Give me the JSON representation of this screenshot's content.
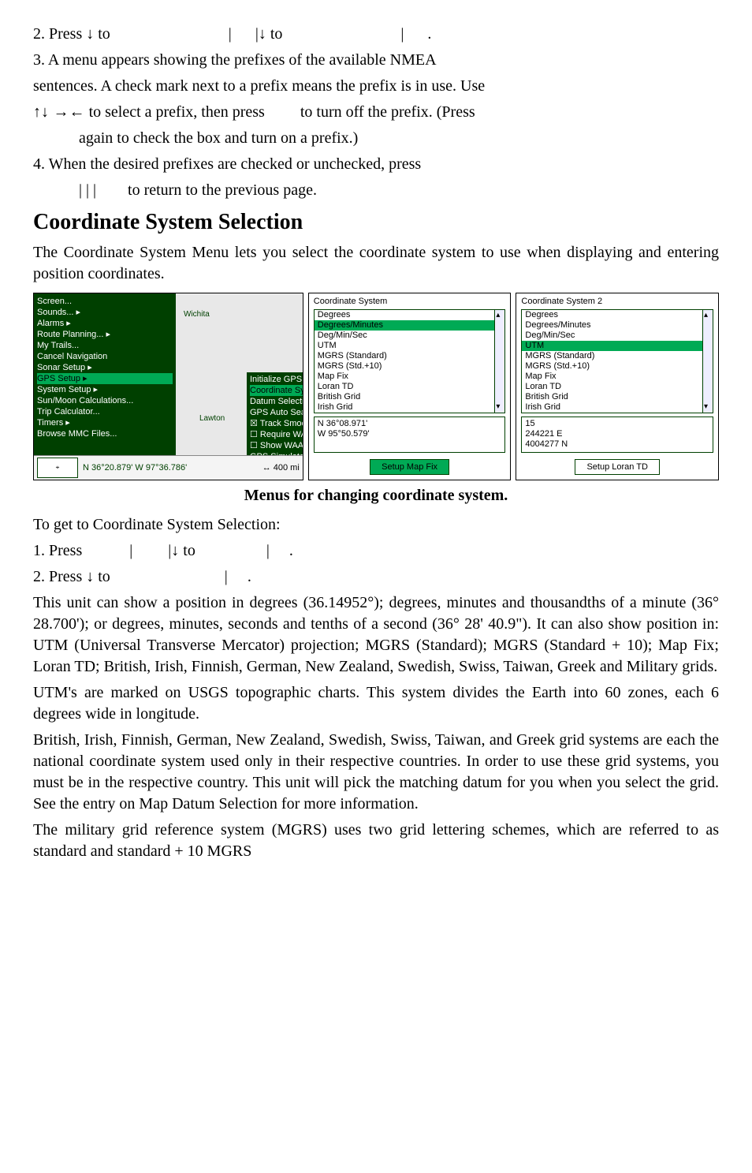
{
  "step2": {
    "prefix": "2. Press ",
    "down": "↓",
    "to1": " to",
    "pipe1": "|",
    "pipe2": "|",
    "down2": "↓",
    "to2": " to",
    "pipe3": "|",
    "dot": "."
  },
  "step3": {
    "line1": "3. A menu appears showing the prefixes of the available NMEA",
    "line2": "sentences. A check mark next to a prefix means the prefix is in use. Use",
    "arrows": "↑↓ →←",
    "mid": " to select a prefix, then press",
    "end": "to turn off the prefix. (Press",
    "cont": "again to check the box and turn on a prefix.)"
  },
  "step4": {
    "line1": "4. When the desired prefixes are checked or unchecked, press",
    "pipes": "|     |     |",
    "ret": "to return to the previous page."
  },
  "heading": "Coordinate System Selection",
  "intro": "The Coordinate System Menu lets you select the coordinate system to use when displaying and entering position coordinates.",
  "caption": "Menus for changing coordinate system.",
  "fig": {
    "leftMenu": [
      "Screen...",
      "Sounds...",
      "Alarms",
      "Route Planning...",
      "My Trails...",
      "Cancel Navigation",
      "Sonar Setup",
      "GPS Setup",
      "System Setup",
      "Sun/Moon Calculations...",
      "Trip Calculator...",
      "Timers",
      "Browse MMC Files..."
    ],
    "leftMenuSelectedIndex": 7,
    "leftMenuArrowIndexes": [
      1,
      2,
      3,
      6,
      7,
      8,
      11
    ],
    "subMenu": [
      "Initialize GPS",
      "Coordinate System...",
      "Datum Selection...",
      "GPS Auto Search",
      "☒ Track Smoothing",
      "☐ Require WAAS",
      "☐ Show WAAS Alarm",
      "GPS Simulator..."
    ],
    "subMenuSelectedIndex": 1,
    "mapCities": {
      "wichita": "Wichita",
      "lawton": "Lawton"
    },
    "coordStrip": "N   36°20.879'    W    97°36.786'",
    "zoom": "↔   400 mi",
    "miniIcon": "⌖",
    "panelMid": {
      "title": "Coordinate System",
      "options": [
        "Degrees",
        "Degrees/Minutes",
        "Deg/Min/Sec",
        "UTM",
        "MGRS (Standard)",
        "MGRS (Std.+10)",
        "Map Fix",
        "Loran TD",
        "British Grid",
        "Irish Grid"
      ],
      "selectedIndex": 1,
      "coords": [
        "N   36°08.971'",
        "W  95°50.579'"
      ],
      "button": "Setup Map Fix"
    },
    "panelRight": {
      "title": "Coordinate System 2",
      "options": [
        "Degrees",
        "Degrees/Minutes",
        "Deg/Min/Sec",
        "UTM",
        "MGRS (Standard)",
        "MGRS (Std.+10)",
        "Map Fix",
        "Loran TD",
        "British Grid",
        "Irish Grid"
      ],
      "selectedIndex": 3,
      "coords": [
        "15",
        " 244221 E",
        "4004277 N"
      ],
      "button": "Setup Loran TD"
    }
  },
  "postFigIntro": "To get to Coordinate System Selection:",
  "post1": {
    "a": "1. Press",
    "b": "|",
    "c": "|",
    "d": "↓",
    "e": " to",
    "f": "|",
    "g": "."
  },
  "post2": {
    "a": "2. Press ",
    "b": "↓",
    "c": " to",
    "d": "|",
    "e": "."
  },
  "body1": "This unit can show a position in degrees (36.14952°); degrees, minutes and thousandths of a minute (36° 28.700'); or degrees, minutes, seconds and tenths of a second (36° 28' 40.9\"). It can also show position in: UTM (Universal Transverse Mercator) projection; MGRS (Standard); MGRS (Standard + 10); Map Fix; Loran TD; British, Irish, Finnish, German, New Zealand, Swedish, Swiss, Taiwan, Greek and Military grids.",
  "body2": "UTM's are marked on USGS topographic charts. This system divides the Earth into 60 zones, each 6 degrees wide in longitude.",
  "body3": "British, Irish, Finnish, Finnish, German, New Zealand, Swedish, Swiss, Taiwan, and Greek grid systems are each the national coordinate system used only in their respective countries. In order to use these grid systems, you must be in the respective country. This unit will pick the matching datum for you when you select the grid. See the entry on Map Datum Selection for more information.",
  "body3fix": "British, Irish, Finnish, German, New Zealand, Swedish, Swiss, Taiwan, and Greek grid systems are each the national coordinate system used only in their respective countries. In order to use these grid systems, you must be in the respective country. This unit will pick the matching datum for you when you select the grid. See the entry on Map Datum Selection for more information.",
  "body4": "The military grid reference system (MGRS) uses two grid lettering schemes, which are referred to as standard and standard + 10 MGRS"
}
